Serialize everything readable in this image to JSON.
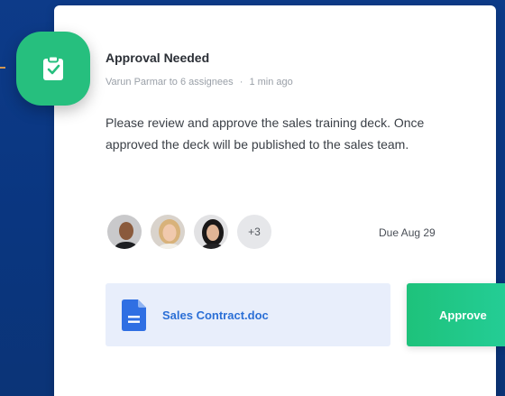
{
  "notification": {
    "title": "Approval Needed",
    "sender": "Varun Parmar to 6 assignees",
    "separator": "·",
    "time": "1 min ago",
    "message": "Please review and approve the sales training deck. Once approved the deck will be published to the sales team.",
    "icon": "clipboard-check-icon"
  },
  "assignees": {
    "more_label": "+3",
    "due": "Due Aug 29"
  },
  "attachment": {
    "name": "Sales Contract.doc",
    "icon": "document-icon"
  },
  "actions": {
    "approve_label": "Approve"
  },
  "colors": {
    "background": "#0b3a86",
    "accent_green": "#26bf7e",
    "link_blue": "#2b6fd6",
    "attachment_bg": "#e8eefb",
    "dash_orange": "#e9a24e"
  }
}
